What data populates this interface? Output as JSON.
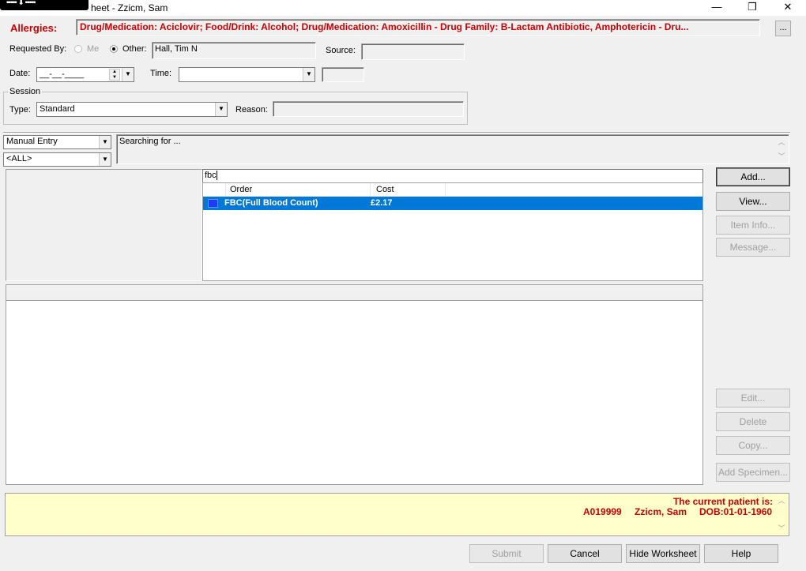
{
  "window": {
    "title": "heet - Zzicm, Sam",
    "minimize": "—",
    "restore": "❐",
    "close": "✕"
  },
  "allergies": {
    "label": "Allergies:",
    "text": "Drug/Medication: Aciclovir; Food/Drink: Alcohol; Drug/Medication: Amoxicillin - Drug Family: B-Lactam Antibiotic, Amphotericin - Dru...",
    "more_button": "..."
  },
  "requested_by": {
    "label": "Requested By:",
    "me_label": "Me",
    "other_label": "Other:",
    "selected": "Other",
    "other_value": "Hall, Tim N"
  },
  "source": {
    "label": "Source:",
    "value": ""
  },
  "date": {
    "label": "Date:",
    "value": "__-__-____"
  },
  "time": {
    "label": "Time:",
    "value": ""
  },
  "session": {
    "group_label": "Session",
    "type_label": "Type:",
    "type_value": "Standard",
    "reason_label": "Reason:",
    "reason_value": ""
  },
  "entry_mode": {
    "value": "Manual Entry"
  },
  "filter": {
    "value": "<ALL>"
  },
  "search_status": "Searching for ...",
  "search": {
    "value": "fbc"
  },
  "orders_table": {
    "columns": [
      "Order",
      "Cost"
    ],
    "rows": [
      {
        "order": "FBC(Full Blood Count)",
        "cost": "£2.17",
        "selected": true
      }
    ]
  },
  "side_buttons": {
    "add": "Add...",
    "view": "View...",
    "item_info": "Item Info...",
    "message": "Message...",
    "edit": "Edit...",
    "delete": "Delete",
    "copy": "Copy...",
    "add_specimen": "Add Specimen..."
  },
  "patient_banner": {
    "line1": "The current patient is:",
    "id": "A019999",
    "name": "Zzicm, Sam",
    "dob": "DOB:01-01-1960"
  },
  "bottom_buttons": {
    "submit": "Submit",
    "cancel": "Cancel",
    "hide_worksheet": "Hide Worksheet",
    "help": "Help"
  },
  "colors": {
    "alert_red": "#cc0000",
    "selection_blue": "#0078d7",
    "banner_yellow": "#ffffcc"
  }
}
